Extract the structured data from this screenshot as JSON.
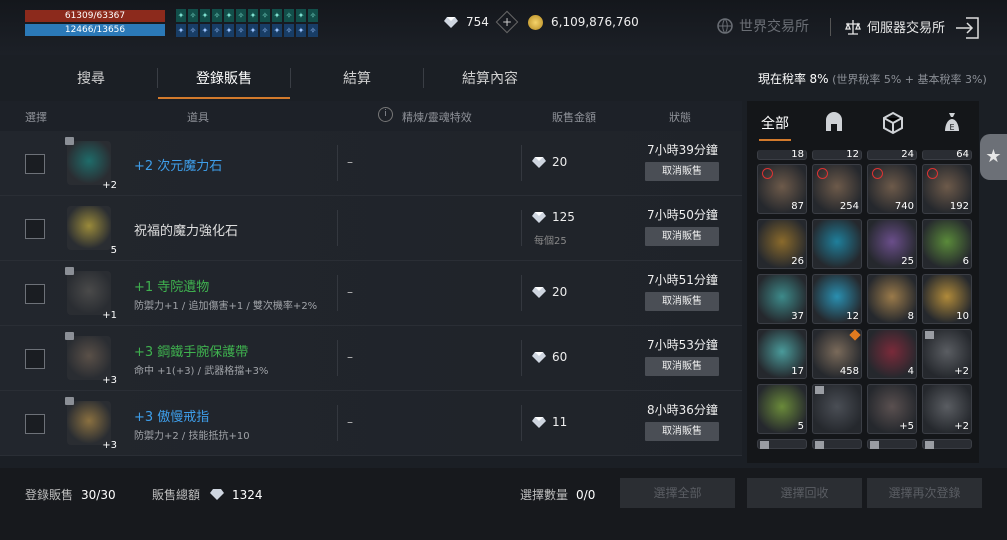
{
  "status": {
    "hp": "61309/63367",
    "mp": "12466/13656"
  },
  "buffs": [
    "✦",
    "✧",
    "✦",
    "✧",
    "✦",
    "✧",
    "✦",
    "✧",
    "✦",
    "✧",
    "✦",
    "✧",
    "✦",
    "✧",
    "✦",
    "✧",
    "✦",
    "✧",
    "✦",
    "✧",
    "✦",
    "✧",
    "✦",
    "✧"
  ],
  "currency": {
    "diamonds": "754",
    "gold": "6,109,876,760"
  },
  "header": {
    "world_exchange": "世界交易所",
    "server_exchange": "伺服器交易所"
  },
  "tabs": [
    "搜尋",
    "登錄販售",
    "結算",
    "結算內容"
  ],
  "tax": {
    "label": "現在稅率",
    "value": "8%",
    "detail": "(世界稅率 5% + 基本稅率 3%)"
  },
  "columns": {
    "select": "選擇",
    "item": "道具",
    "refine": "精煉/靈魂特效",
    "price": "販售金額",
    "status": "狀態"
  },
  "listings": [
    {
      "name": "+2 次元魔力石",
      "sub": "",
      "level": "+2",
      "refine": "–",
      "price": "20",
      "each": "",
      "time": "7小時39分鐘",
      "cancel": "取消販售",
      "color": "b"
    },
    {
      "name": "祝福的魔力強化石",
      "sub": "",
      "level": "5",
      "refine": "",
      "price": "125",
      "each": "每個25",
      "time": "7小時50分鐘",
      "cancel": "取消販售",
      "color": "w"
    },
    {
      "name": "+1 寺院遺物",
      "sub": "防禦力+1 / 追加傷害+1 / 雙次機率+2%",
      "level": "+1",
      "refine": "–",
      "price": "20",
      "each": "",
      "time": "7小時51分鐘",
      "cancel": "取消販售",
      "color": "g"
    },
    {
      "name": "+3 鋼鐵手腕保護帶",
      "sub": "命中 +1(+3) / 武器格擋+3%",
      "level": "+3",
      "refine": "–",
      "price": "60",
      "each": "",
      "time": "7小時53分鐘",
      "cancel": "取消販售",
      "color": "g"
    },
    {
      "name": "+3 傲慢戒指",
      "sub": "防禦力+2 / 技能抵抗+10",
      "level": "+3",
      "refine": "–",
      "price": "11",
      "each": "",
      "time": "8小時36分鐘",
      "cancel": "取消販售",
      "color": "b"
    }
  ],
  "footer": {
    "registered_label": "登錄販售",
    "registered_value": "30/30",
    "total_label": "販售總額",
    "total_value": "1324",
    "selected_label": "選擇數量",
    "selected_value": "0/0",
    "btn_select_all": "選擇全部",
    "btn_recall": "選擇回收",
    "btn_relist": "選擇再次登錄"
  },
  "inventory": {
    "tab_all": "全部",
    "top_partial": [
      "18",
      "12",
      "24",
      "64"
    ],
    "items": [
      {
        "n": "87",
        "lock": true,
        "c": "#6d5a4a"
      },
      {
        "n": "254",
        "lock": true,
        "c": "#6d5a4a"
      },
      {
        "n": "740",
        "lock": true,
        "c": "#6d5a4a"
      },
      {
        "n": "192",
        "lock": true,
        "c": "#6d5a4a"
      },
      {
        "n": "26",
        "c": "#8a6a2c"
      },
      {
        "n": "",
        "c": "#1f7f9b"
      },
      {
        "n": "25",
        "c": "#6a4e8a"
      },
      {
        "n": "6",
        "c": "#5a8a3a"
      },
      {
        "n": "37",
        "c": "#3d8a8a"
      },
      {
        "n": "12",
        "c": "#2a8fb0"
      },
      {
        "n": "8",
        "c": "#9a7a4a"
      },
      {
        "n": "10",
        "c": "#b08a3a"
      },
      {
        "n": "17",
        "c": "#4a9a9a"
      },
      {
        "n": "458",
        "pin": true,
        "c": "#7a6a5a"
      },
      {
        "n": "4",
        "c": "#7a2a3a"
      },
      {
        "n": "+2",
        "badge": true,
        "c": "#5a5d62"
      },
      {
        "n": "5",
        "c": "#6a8a3a"
      },
      {
        "n": "",
        "badge": true,
        "c": "#4a4e55"
      },
      {
        "n": "+5",
        "c": "#5a5050"
      },
      {
        "n": "+2",
        "c": "#5a5d62"
      }
    ]
  }
}
